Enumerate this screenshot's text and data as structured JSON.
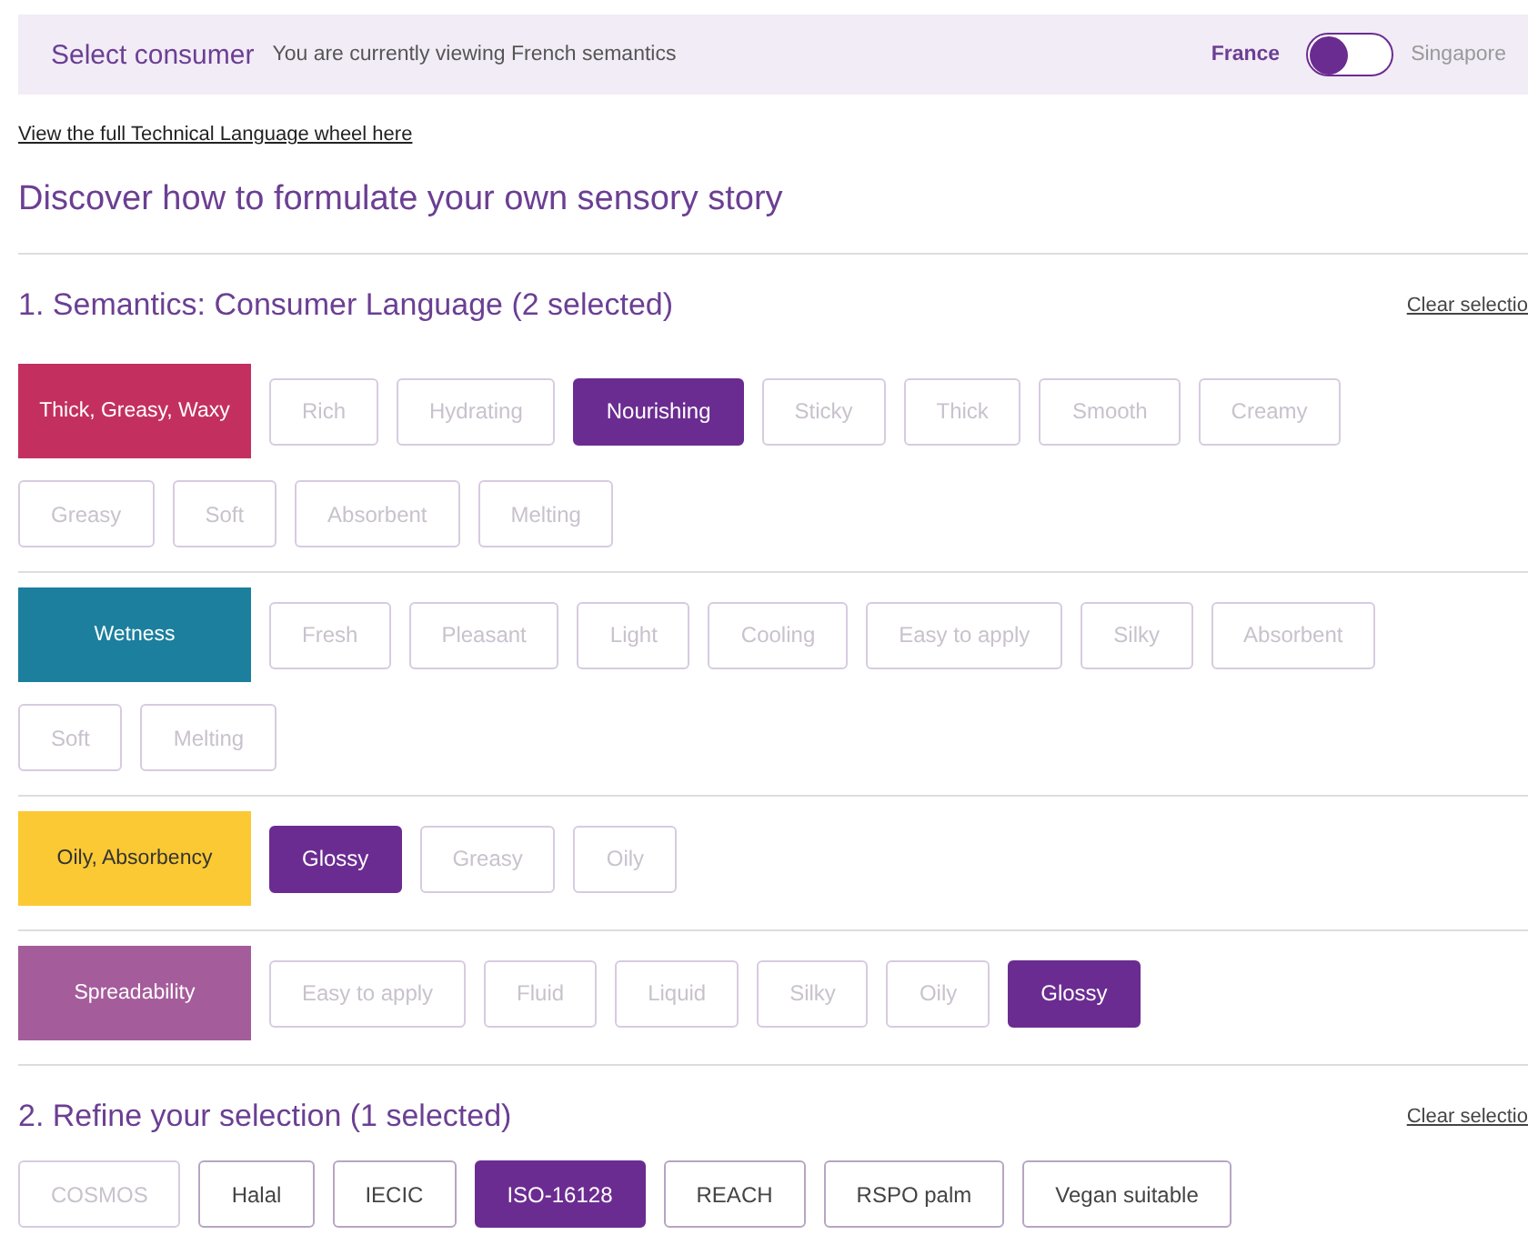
{
  "consumer_bar": {
    "title": "Select consumer",
    "subtitle": "You are currently viewing French semantics",
    "options": [
      {
        "label": "France",
        "selected": true
      },
      {
        "label": "Singapore",
        "selected": false
      }
    ]
  },
  "wheel_link": "View the full Technical Language wheel here",
  "heading": "Discover how to formulate your own sensory story",
  "sections": [
    {
      "title": "1. Semantics: Consumer Language (2 selected)",
      "clear_link": "Clear selectio",
      "categories": [
        {
          "label": "Thick, Greasy, Waxy",
          "color": "#c3305f",
          "chips": [
            {
              "label": "Rich",
              "selected": false,
              "disabled": true
            },
            {
              "label": "Hydrating",
              "selected": false,
              "disabled": true
            },
            {
              "label": "Nourishing",
              "selected": true,
              "disabled": false
            },
            {
              "label": "Sticky",
              "selected": false,
              "disabled": true
            },
            {
              "label": "Thick",
              "selected": false,
              "disabled": true
            },
            {
              "label": "Smooth",
              "selected": false,
              "disabled": true
            },
            {
              "label": "Creamy",
              "selected": false,
              "disabled": true
            },
            {
              "label": "Greasy",
              "selected": false,
              "disabled": true
            },
            {
              "label": "Soft",
              "selected": false,
              "disabled": true
            },
            {
              "label": "Absorbent",
              "selected": false,
              "disabled": true
            },
            {
              "label": "Melting",
              "selected": false,
              "disabled": true
            }
          ]
        },
        {
          "label": "Wetness",
          "color": "#1b7f9d",
          "chips": [
            {
              "label": "Fresh",
              "selected": false,
              "disabled": true
            },
            {
              "label": "Pleasant",
              "selected": false,
              "disabled": true
            },
            {
              "label": "Light",
              "selected": false,
              "disabled": true
            },
            {
              "label": "Cooling",
              "selected": false,
              "disabled": true
            },
            {
              "label": "Easy to apply",
              "selected": false,
              "disabled": true
            },
            {
              "label": "Silky",
              "selected": false,
              "disabled": true
            },
            {
              "label": "Absorbent",
              "selected": false,
              "disabled": true
            },
            {
              "label": "Soft",
              "selected": false,
              "disabled": true
            },
            {
              "label": "Melting",
              "selected": false,
              "disabled": true
            }
          ]
        },
        {
          "label": "Oily, Absorbency",
          "color": "#fbc933",
          "chips": [
            {
              "label": "Glossy",
              "selected": true,
              "disabled": false
            },
            {
              "label": "Greasy",
              "selected": false,
              "disabled": true
            },
            {
              "label": "Oily",
              "selected": false,
              "disabled": true
            }
          ]
        },
        {
          "label": "Spreadability",
          "color": "#a55c9b",
          "chips": [
            {
              "label": "Easy to apply",
              "selected": false,
              "disabled": true
            },
            {
              "label": "Fluid",
              "selected": false,
              "disabled": true
            },
            {
              "label": "Liquid",
              "selected": false,
              "disabled": true
            },
            {
              "label": "Silky",
              "selected": false,
              "disabled": true
            },
            {
              "label": "Oily",
              "selected": false,
              "disabled": true
            },
            {
              "label": "Glossy",
              "selected": true,
              "disabled": false
            }
          ]
        }
      ]
    },
    {
      "title": "2. Refine your selection (1 selected)",
      "clear_link": "Clear selectio",
      "chips": [
        {
          "label": "COSMOS",
          "selected": false,
          "disabled": true
        },
        {
          "label": "Halal",
          "selected": false,
          "disabled": false
        },
        {
          "label": "IECIC",
          "selected": false,
          "disabled": false
        },
        {
          "label": "ISO-16128",
          "selected": true,
          "disabled": false
        },
        {
          "label": "REACH",
          "selected": false,
          "disabled": false
        },
        {
          "label": "RSPO palm",
          "selected": false,
          "disabled": false
        },
        {
          "label": "Vegan suitable",
          "selected": false,
          "disabled": false
        }
      ]
    }
  ]
}
